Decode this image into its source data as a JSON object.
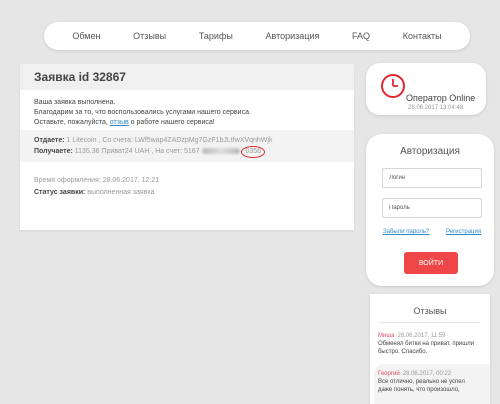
{
  "nav": {
    "items": [
      "Обмен",
      "Отзывы",
      "Тарифы",
      "Авторизация",
      "FAQ",
      "Контакты"
    ]
  },
  "order": {
    "title": "Заявка id 32867",
    "message_line1": "Ваша заявка выполнена.",
    "message_line2": "Благодарим за то, что воспользовались услугами нашего сервиса.",
    "message_line3_pre": "Оставьте, пожалуйста,",
    "message_link": "отзыв",
    "message_line3_post": "о работе нашего сервиса!",
    "give_label": "Отдаете:",
    "give_value": "1 Litecoin , Со счета: LWf5wap4ZADzpMg7GzF1bJLtfwXVqnhWjk",
    "receive_label": "Получаете:",
    "receive_value": "1135.36 Приват24 UAH , На счет: 5167",
    "receive_card_end": "0356",
    "created_label": "Время оформления:",
    "created_value": "28.06.2017, 12:21",
    "status_label": "Статус заявки:",
    "status_value": "выполненная заявка"
  },
  "operator": {
    "title": "Оператор Online",
    "time": "28.06.2017 13:04:48"
  },
  "auth": {
    "title": "Авторизация",
    "login_placeholder": "Логин",
    "password_placeholder": "Пароль",
    "forgot": "Забыли пароль?",
    "register": "Регистрация",
    "submit": "ВОЙТИ"
  },
  "reviews": {
    "title": "Отзывы",
    "items": [
      {
        "name": "Миша",
        "date": "28.06.2017, 11:59",
        "text": "Обменял битки на приват, пришли быстро. Спасибо."
      },
      {
        "name": "Георгий",
        "date": "28.06.2017, 00:22",
        "text": "Все отлично, реально не успел даже понять, что произошло,"
      }
    ]
  },
  "colors": {
    "accent_red": "#ef4747",
    "link_blue": "#2f8ccf"
  }
}
